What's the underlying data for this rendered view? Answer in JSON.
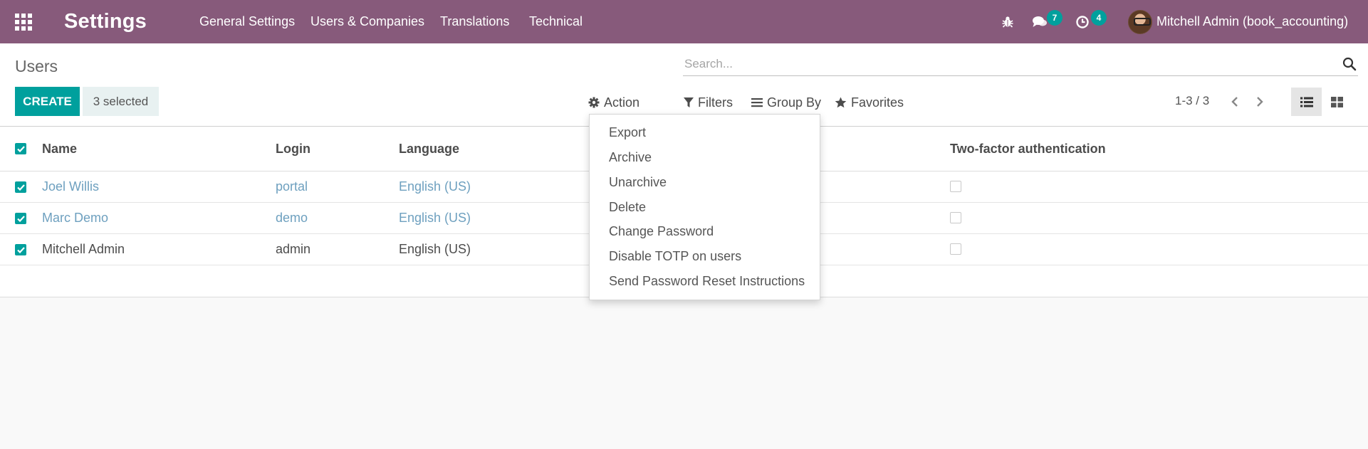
{
  "navbar": {
    "brand": "Settings",
    "menu": [
      "General Settings",
      "Users & Companies",
      "Translations",
      "Technical"
    ],
    "chat_count": "7",
    "activity_count": "4",
    "user_name": "Mitchell Admin (book_accounting)"
  },
  "control_panel": {
    "breadcrumb": "Users",
    "search_placeholder": "Search...",
    "create_label": "CREATE",
    "selected_label": "3 selected",
    "action_label": "Action",
    "filters_label": "Filters",
    "groupby_label": "Group By",
    "favorites_label": "Favorites",
    "pager": "1-3 / 3"
  },
  "action_menu": {
    "items": [
      "Export",
      "Archive",
      "Unarchive",
      "Delete",
      "Change Password",
      "Disable TOTP on users",
      "Send Password Reset Instructions"
    ]
  },
  "table": {
    "headers": [
      "Name",
      "Login",
      "Language",
      "Two-factor authentication"
    ],
    "rows": [
      {
        "name": "Joel Willis",
        "login": "portal",
        "language": "English (US)",
        "selected": true,
        "two_factor": false
      },
      {
        "name": "Marc Demo",
        "login": "demo",
        "language": "English (US)",
        "selected": true,
        "two_factor": false
      },
      {
        "name": "Mitchell Admin",
        "login": "admin",
        "language": "English (US)",
        "selected": true,
        "two_factor": false
      }
    ]
  },
  "colors": {
    "navbar": "#875a7b",
    "accent": "#00a09d",
    "link": "#6ea0bf"
  }
}
